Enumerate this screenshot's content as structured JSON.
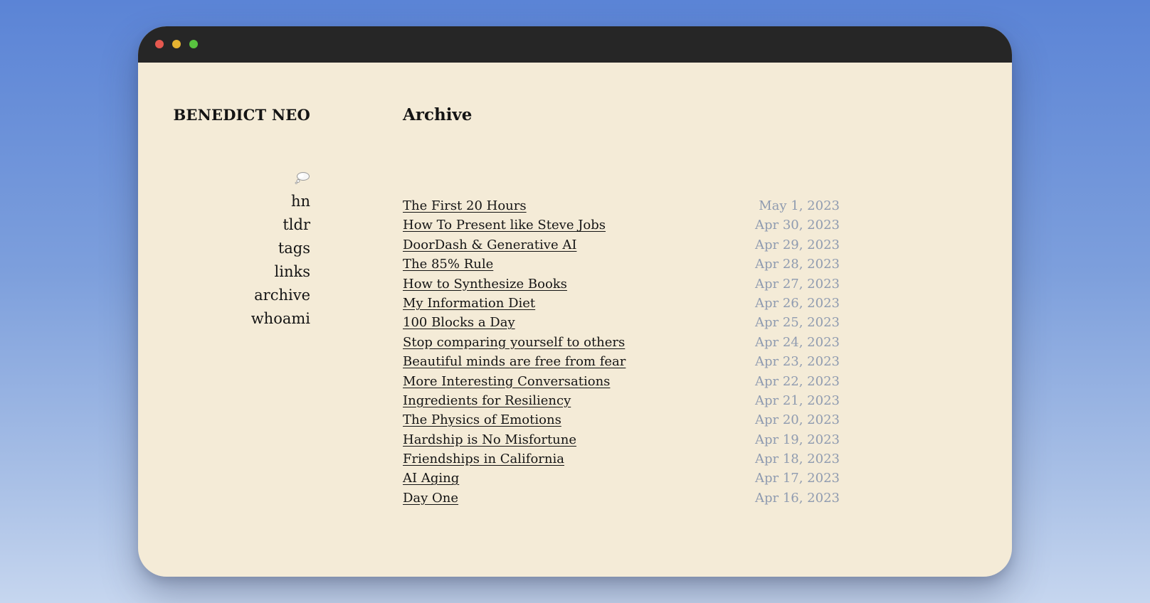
{
  "site": {
    "brand": "BENEDICT NEO"
  },
  "nav": {
    "bubble_icon": "thought-bubble-icon",
    "items": [
      {
        "label": "hn"
      },
      {
        "label": "tldr"
      },
      {
        "label": "tags"
      },
      {
        "label": "links"
      },
      {
        "label": "archive"
      },
      {
        "label": "whoami"
      }
    ]
  },
  "main": {
    "title": "Archive",
    "posts": [
      {
        "title": "The First 20 Hours",
        "date": "May 1, 2023"
      },
      {
        "title": "How To Present like Steve Jobs",
        "date": "Apr 30, 2023"
      },
      {
        "title": "DoorDash & Generative AI",
        "date": "Apr 29, 2023"
      },
      {
        "title": "The 85% Rule",
        "date": "Apr 28, 2023"
      },
      {
        "title": "How to Synthesize Books",
        "date": "Apr 27, 2023"
      },
      {
        "title": "My Information Diet",
        "date": "Apr 26, 2023"
      },
      {
        "title": "100 Blocks a Day",
        "date": "Apr 25, 2023"
      },
      {
        "title": "Stop comparing yourself to others",
        "date": "Apr 24, 2023"
      },
      {
        "title": "Beautiful minds are free from fear",
        "date": "Apr 23, 2023"
      },
      {
        "title": "More Interesting Conversations",
        "date": "Apr 22, 2023"
      },
      {
        "title": "Ingredients for Resiliency",
        "date": "Apr 21, 2023"
      },
      {
        "title": "The Physics of Emotions",
        "date": "Apr 20, 2023"
      },
      {
        "title": "Hardship is No Misfortune",
        "date": "Apr 19, 2023"
      },
      {
        "title": "Friendships in California",
        "date": "Apr 18, 2023"
      },
      {
        "title": "AI Aging",
        "date": "Apr 17, 2023"
      },
      {
        "title": "Day One",
        "date": "Apr 16, 2023"
      }
    ]
  },
  "colors": {
    "page_background": "#f4ebd7",
    "titlebar": "#262626",
    "text": "#141414",
    "date": "#8f9bb0",
    "close": "#e5584f",
    "minimize": "#e6b331",
    "zoom": "#58c33f"
  }
}
